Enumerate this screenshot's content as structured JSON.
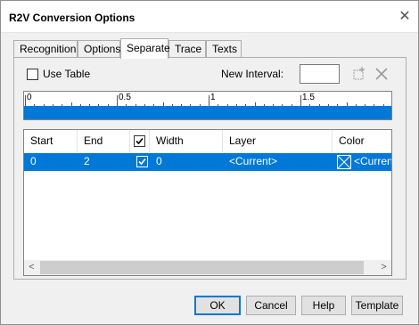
{
  "window": {
    "title": "R2V Conversion Options",
    "close_glyph": "✕"
  },
  "tabs": [
    {
      "label": "Recognition",
      "active": false
    },
    {
      "label": "Options",
      "active": false
    },
    {
      "label": "Separate",
      "active": true
    },
    {
      "label": "Trace",
      "active": false
    },
    {
      "label": "Texts",
      "active": false
    }
  ],
  "separate": {
    "use_table_label": "Use Table",
    "use_table_checked": false,
    "new_interval_label": "New Interval:",
    "new_interval_value": "",
    "add_icon": "add-interval-icon",
    "delete_icon": "delete-interval-icon"
  },
  "ruler": {
    "labels": [
      "0",
      "0.5",
      "1",
      "1.5"
    ],
    "range": [
      0,
      2
    ],
    "bar_color": "#0078d7"
  },
  "table": {
    "columns": [
      "Start",
      "End",
      "",
      "Width",
      "Layer",
      "Color"
    ],
    "header_checkbox_checked": true,
    "rows": [
      {
        "start": "0",
        "end": "2",
        "checked": true,
        "width": "0",
        "layer": "<Current>",
        "color": "<Current"
      }
    ],
    "selection_color": "#0078d7"
  },
  "scrollbar": {
    "left_arrow": "<",
    "right_arrow": ">"
  },
  "buttons": {
    "ok": "OK",
    "cancel": "Cancel",
    "help": "Help",
    "template": "Template"
  }
}
